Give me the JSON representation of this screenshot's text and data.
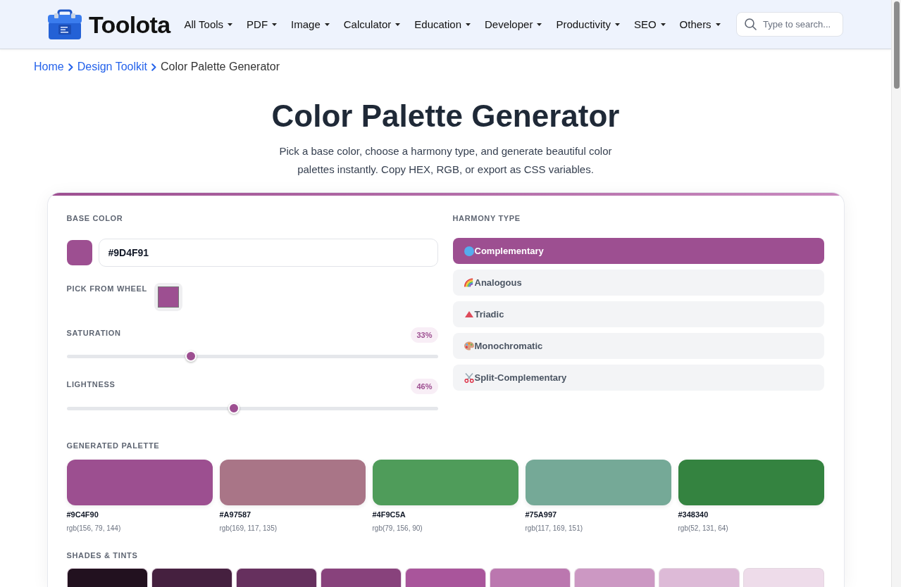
{
  "header": {
    "logo": "Toolota",
    "nav": [
      "All Tools",
      "PDF",
      "Image",
      "Calculator",
      "Education",
      "Developer",
      "Productivity",
      "SEO",
      "Others"
    ],
    "search": {
      "placeholder": "Type to search..."
    }
  },
  "breadcrumb": [
    {
      "label": "Home",
      "kind": "link"
    },
    {
      "label": "Design Toolkit",
      "kind": "link"
    },
    {
      "label": "Color Palette Generator",
      "kind": "current"
    }
  ],
  "title": "Color Palette Generator",
  "description": "Pick a base color, choose a harmony type, and generate beautiful color palettes instantly. Copy HEX, RGB, or export as CSS variables.",
  "base_color": {
    "label": "BASE COLOR",
    "value": "#9D4F91",
    "wheel_label": "PICK FROM WHEEL"
  },
  "sliders": [
    {
      "label": "SATURATION",
      "reading": "33%",
      "level": 0.33
    },
    {
      "label": "LIGHTNESS",
      "reading": "46%",
      "level": 0.45
    }
  ],
  "harmony": {
    "label": "HARMONY TYPE",
    "options": [
      {
        "label": "Complementary",
        "selected": true
      },
      {
        "label": "Analogous",
        "selected": false
      },
      {
        "label": "Triadic",
        "selected": false
      },
      {
        "label": "Monochromatic",
        "selected": false
      },
      {
        "label": "Split-Complementary",
        "selected": false
      }
    ]
  },
  "palette": {
    "label": "GENERATED PALETTE",
    "swatches": [
      {
        "color": "#9c4f90",
        "hex": "#9C4F90",
        "rgb": "rgb(156, 79, 144)"
      },
      {
        "color": "#a97587",
        "hex": "#A97587",
        "rgb": "rgb(169, 117, 135)"
      },
      {
        "color": "#4f9c5a",
        "hex": "#4F9C5A",
        "rgb": "rgb(79, 156, 90)"
      },
      {
        "color": "#75a997",
        "hex": "#75A997",
        "rgb": "rgb(117, 169, 151)"
      },
      {
        "color": "#348340",
        "hex": "#348340",
        "rgb": "rgb(52, 131, 64)"
      }
    ]
  },
  "shades": {
    "label": "SHADES & TINTS",
    "swatches": [
      {
        "color": "#22111f"
      },
      {
        "color": "#45203f"
      },
      {
        "color": "#66305e"
      },
      {
        "color": "#88427c"
      },
      {
        "color": "#a9559b"
      },
      {
        "color": "#bb77af"
      },
      {
        "color": "#cc98c3"
      },
      {
        "color": "#ddbad7"
      },
      {
        "color": "#eedcea"
      }
    ]
  }
}
